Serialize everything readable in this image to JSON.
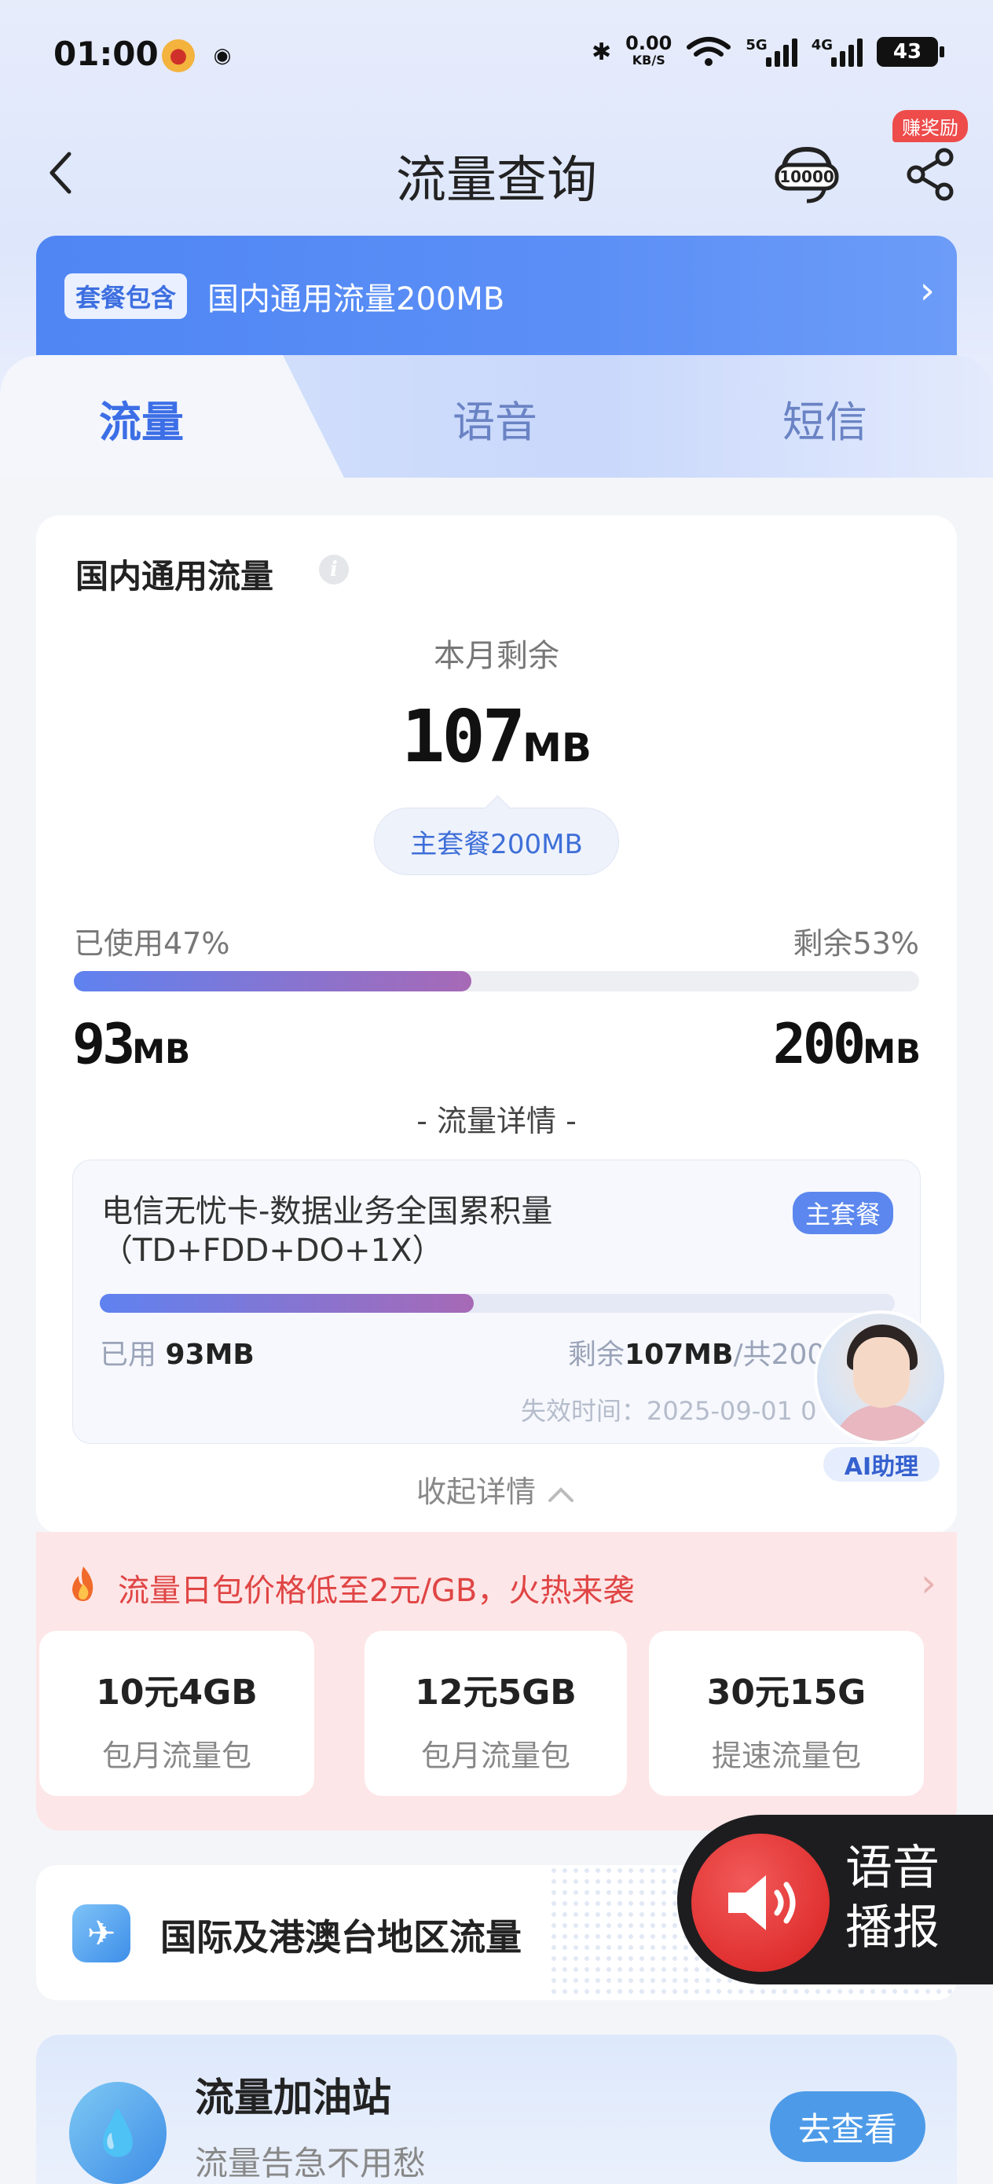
{
  "status_bar": {
    "time": "01:00",
    "net_speed_value": "0.00",
    "net_speed_unit": "KB/S",
    "sig1_label": "5G",
    "sig2_label": "4G",
    "battery": "43"
  },
  "nav": {
    "back_icon": "chevron-left-icon",
    "title": "流量查询",
    "service_icon": "10000-service-icon",
    "share_icon": "share-icon",
    "earn_badge": "赚奖励"
  },
  "plan_banner": {
    "tag": "套餐包含",
    "text": "国内通用流量200MB"
  },
  "tabs": [
    {
      "label": "流量",
      "active": true
    },
    {
      "label": "语音",
      "active": false
    },
    {
      "label": "短信",
      "active": false
    }
  ],
  "usage": {
    "title": "国内通用流量",
    "remain_label": "本月剩余",
    "remain_value": "107",
    "remain_unit": "MB",
    "plan_pill": "主套餐200MB",
    "used_pct_text": "已使用47%",
    "left_pct_text": "剩余53%",
    "used_fraction": 0.47,
    "used_value": "93",
    "used_unit": "MB",
    "total_value": "200",
    "total_unit": "MB",
    "detail_label": "- 流量详情 -",
    "collapse_label": "收起详情"
  },
  "detail": {
    "package_name": "电信无忧卡-数据业务全国累积量（TD+FDD+DO+1X）",
    "badge": "主套餐",
    "used_fraction": 0.47,
    "used_prefix": "已用",
    "used_value": "93MB",
    "remain_prefix": "剩余",
    "remain_value": "107MB",
    "total_suffix": "/共200",
    "expire": "失效时间：2025-09-01 0"
  },
  "ai_assistant": {
    "label": "AI助理"
  },
  "promo": {
    "headline": "流量日包价格低至2元/GB，火热来袭",
    "items": [
      {
        "title": "10元4GB",
        "sub": "包月流量包"
      },
      {
        "title": "12元5GB",
        "sub": "包月流量包"
      },
      {
        "title": "30元15G",
        "sub": "提速流量包"
      }
    ]
  },
  "intl": {
    "title": "国际及港澳台地区流量"
  },
  "voice_broadcast": {
    "line1": "语音",
    "line2": "播报"
  },
  "refuel": {
    "title": "流量加油站",
    "subtitle": "流量告急不用愁",
    "button": "去查看"
  },
  "colors": {
    "accent": "#3c6ee6",
    "progress_start": "#5f82f0",
    "progress_end": "#a769b6",
    "promo_red": "#e04545"
  }
}
